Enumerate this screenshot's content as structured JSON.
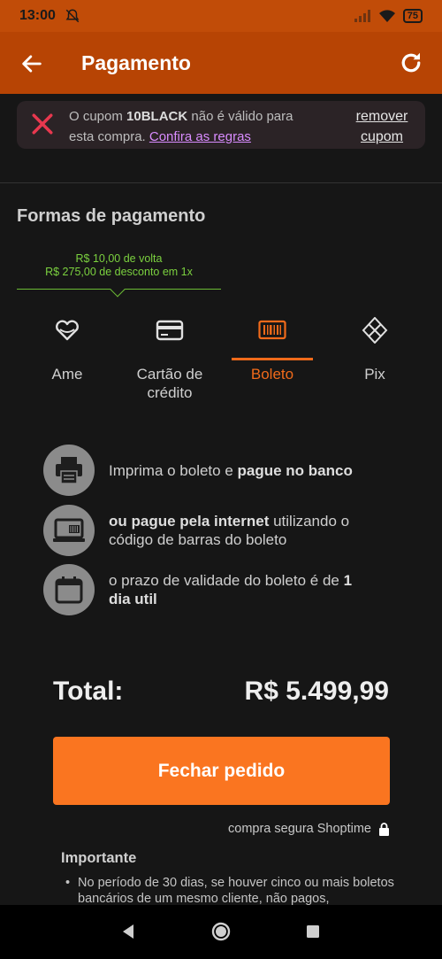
{
  "status_bar": {
    "time": "13:00",
    "battery": "75"
  },
  "app_bar": {
    "title": "Pagamento",
    "back_icon": "arrow-left-icon",
    "refresh_icon": "refresh-icon"
  },
  "coupon_banner": {
    "prefix": "O cupom ",
    "code": "10BLACK",
    "suffix": " não é válido para esta compra. ",
    "rules_link": "Confira as regras",
    "remove_label": "remover cupom",
    "icon": "close-icon",
    "icon_color": "#e8384f"
  },
  "payment": {
    "section_title": "Formas de pagamento",
    "promo_line1": "R$ 10,00 de volta",
    "promo_line2": "R$ 275,00 de desconto em 1x",
    "tabs": [
      {
        "label": "Ame",
        "icon": "heart-icon",
        "active": false
      },
      {
        "label": "Cartão de crédito",
        "icon": "credit-card-icon",
        "active": false
      },
      {
        "label": "Boleto",
        "icon": "barcode-icon",
        "active": true
      },
      {
        "label": "Pix",
        "icon": "pix-icon",
        "active": false
      }
    ]
  },
  "boleto_info": [
    {
      "icon": "printer-icon",
      "before": "Imprima o boleto e ",
      "bold": "pague no banco",
      "after": ""
    },
    {
      "icon": "laptop-barcode-icon",
      "before": "",
      "bold": "ou pague pela internet",
      "after": " utilizando o código de barras do boleto"
    },
    {
      "icon": "calendar-icon",
      "before": "o prazo de validade do boleto é de ",
      "bold": "1 dia util",
      "after": ""
    }
  ],
  "total": {
    "label": "Total:",
    "value": "R$ 5.499,99"
  },
  "checkout_button": "Fechar pedido",
  "secure_text": "compra segura Shoptime",
  "important": {
    "title": "Importante",
    "item": "No período de 30 dias, se houver cinco ou mais boletos bancários de um mesmo cliente, não pagos,"
  },
  "colors": {
    "accent": "#fa7520",
    "header": "#b74404",
    "status_bar": "#c14c08",
    "promo_green": "#7bd13f",
    "link": "#d98cff"
  }
}
